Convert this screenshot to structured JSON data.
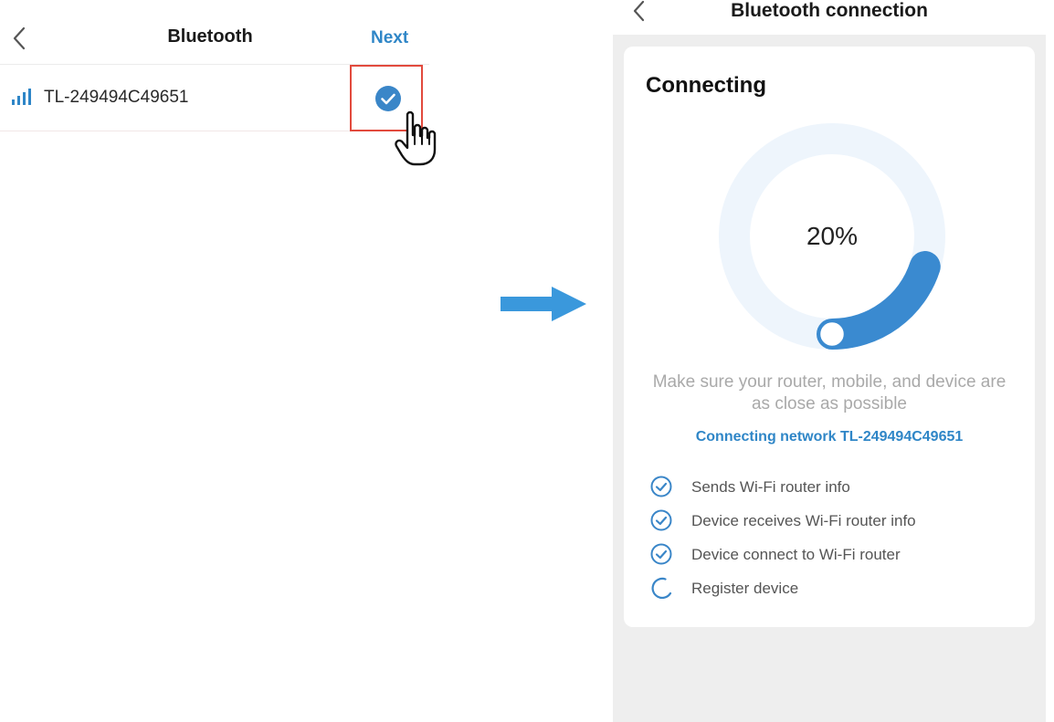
{
  "left": {
    "header": {
      "title": "Bluetooth",
      "next_label": "Next"
    },
    "device": {
      "name": "TL-249494C49651",
      "selected": true
    }
  },
  "right": {
    "header": {
      "title": "Bluetooth connection"
    },
    "card": {
      "heading": "Connecting",
      "progress": {
        "value": 0.2,
        "label": "20%"
      },
      "hint_line1": "Make sure your router, mobile, and device are",
      "hint_line2": "as close as possible",
      "network_status": "Connecting network TL-249494C49651",
      "steps": [
        {
          "label": "Sends Wi-Fi router info",
          "status": "done",
          "icon": "check-circle-icon"
        },
        {
          "label": "Device receives Wi-Fi router info",
          "status": "done",
          "icon": "check-circle-icon"
        },
        {
          "label": "Device connect to Wi-Fi router",
          "status": "done",
          "icon": "check-circle-icon"
        },
        {
          "label": "Register device",
          "status": "in-progress",
          "icon": "spinner-icon"
        }
      ]
    }
  },
  "colors": {
    "accent": "#2f86c7",
    "progress_fill": "#3a8ad0",
    "progress_track": "#eef5fc",
    "highlight": "#e24a3d",
    "arrow": "#3a98dc"
  },
  "icons": [
    "back-chevron-icon",
    "signal-bars-icon",
    "check-circle-icon",
    "hand-pointer-icon",
    "arrow-right-icon",
    "spinner-icon"
  ]
}
